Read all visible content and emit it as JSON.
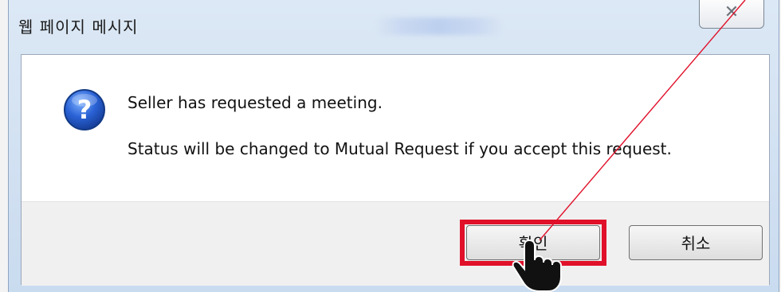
{
  "dialog": {
    "title": "웹 페이지 메시지",
    "close_icon": "close-icon",
    "message": {
      "line1": "Seller has requested a meeting.",
      "line2": "Status will be changed to Mutual Request if you accept this request."
    },
    "icon": "question-icon",
    "buttons": {
      "ok_label": "확인",
      "cancel_label": "취소"
    }
  },
  "annotation": {
    "highlight_color": "#e0102a",
    "cursor_icon": "hand-pointer-icon"
  }
}
